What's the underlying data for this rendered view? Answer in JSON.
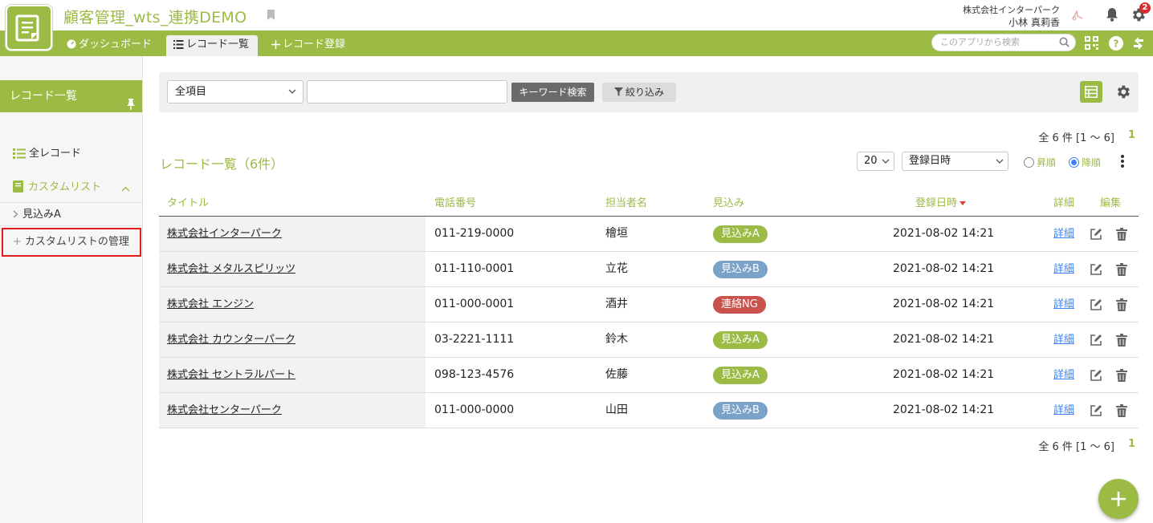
{
  "app": {
    "title": "顧客管理_wts_連携DEMO",
    "company": "株式会社インターパーク",
    "user": "小林 真莉香",
    "notification_count": "2"
  },
  "nav": {
    "dashboard": "ダッシュボード",
    "list": "レコード一覧",
    "register": "レコード登録",
    "search_placeholder": "このアプリから検索"
  },
  "sidebar": {
    "header": "レコード一覧",
    "all_records": "全レコード",
    "custom_list": "カスタムリスト",
    "items": [
      {
        "label": "見込みA"
      }
    ],
    "manage": "カスタムリストの管理"
  },
  "filter": {
    "field_select": "全項目",
    "keyword_value": "",
    "keyword_button": "キーワード検索",
    "filter_button": "絞り込み"
  },
  "list": {
    "total_text": "全 6 件 [1 〜 6]",
    "page": "1",
    "title": "レコード一覧（6件）",
    "per_page": "20",
    "sort_field": "登録日時",
    "asc_label": "昇順",
    "desc_label": "降順",
    "sort_order": "desc"
  },
  "table": {
    "columns": {
      "title": "タイトル",
      "phone": "電話番号",
      "person": "担当者名",
      "prospect": "見込み",
      "date": "登録日時",
      "detail": "詳細",
      "edit": "編集"
    },
    "rows": [
      {
        "title": "株式会社インターパーク",
        "phone": "011-219-0000",
        "person": "檜垣",
        "prospect": "見込みA",
        "prospect_color": "#9bbb45",
        "date": "2021-08-02 14:21",
        "detail": "詳細"
      },
      {
        "title": "株式会社 メタルスピリッツ",
        "phone": "011-110-0001",
        "person": "立花",
        "prospect": "見込みB",
        "prospect_color": "#7ba3c9",
        "date": "2021-08-02 14:21",
        "detail": "詳細"
      },
      {
        "title": "株式会社 エンジン",
        "phone": "011-000-0001",
        "person": "酒井",
        "prospect": "連絡NG",
        "prospect_color": "#c9524d",
        "date": "2021-08-02 14:21",
        "detail": "詳細"
      },
      {
        "title": "株式会社 カウンターパーク",
        "phone": "03-2221-1111",
        "person": "鈴木",
        "prospect": "見込みA",
        "prospect_color": "#9bbb45",
        "date": "2021-08-02 14:21",
        "detail": "詳細"
      },
      {
        "title": "株式会社 セントラルパート",
        "phone": "098-123-4576",
        "person": "佐藤",
        "prospect": "見込みA",
        "prospect_color": "#9bbb45",
        "date": "2021-08-02 14:21",
        "detail": "詳細"
      },
      {
        "title": "株式会社センターパーク",
        "phone": "011-000-0000",
        "person": "山田",
        "prospect": "見込みB",
        "prospect_color": "#7ba3c9",
        "date": "2021-08-02 14:21",
        "detail": "詳細"
      }
    ]
  },
  "colors": {
    "brand": "#9bbb45",
    "link": "#3d82f5",
    "highlight_border": "#e21b1b"
  }
}
